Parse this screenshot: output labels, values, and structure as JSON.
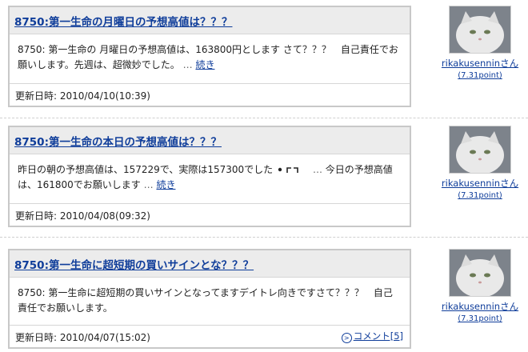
{
  "posts": [
    {
      "title": "8750:第一生命の月曜日の予想高値は？？？",
      "body": "8750: 第一生命の 月曜日の予想高値は、163800円とします さて？？？　自己責任でお願いします。先週は、超微妙でした。",
      "ellipsis": " … ",
      "more": "続き",
      "date_label": "更新日時:",
      "date": "2010/04/10(10:39)"
    },
    {
      "title": "8750:第一生命の本日の予想高値は？？？",
      "body_a": "昨日の朝の予想高値は、157229で、実際は157300でした",
      "body_b": "今日の予想高値は、161800でお願いします",
      "ellipsis_mid": " … ",
      "ellipsis": " … ",
      "more": "続き",
      "date_label": "更新日時:",
      "date": "2010/04/08(09:32)"
    },
    {
      "title": "8750:第一生命に超短期の買いサインとな？？？",
      "body": "8750: 第一生命に超短期の買いサインとなってますデイトレ向きですさて？？？　自己責任でお願いします。",
      "date_label": "更新日時:",
      "date": "2010/04/07(15:02)",
      "comment": "コメント[5]"
    }
  ],
  "users": [
    {
      "name": "rikakusenninさん",
      "point": "(7.31point)"
    },
    {
      "name": "rikakusenninさん",
      "point": "(7.31point)"
    },
    {
      "name": "rikakusenninさん",
      "point": "(7.31point)"
    }
  ],
  "colors": {
    "link": "#0f3d9a",
    "title_bg": "#ececec",
    "border": "#c8c8c8"
  }
}
